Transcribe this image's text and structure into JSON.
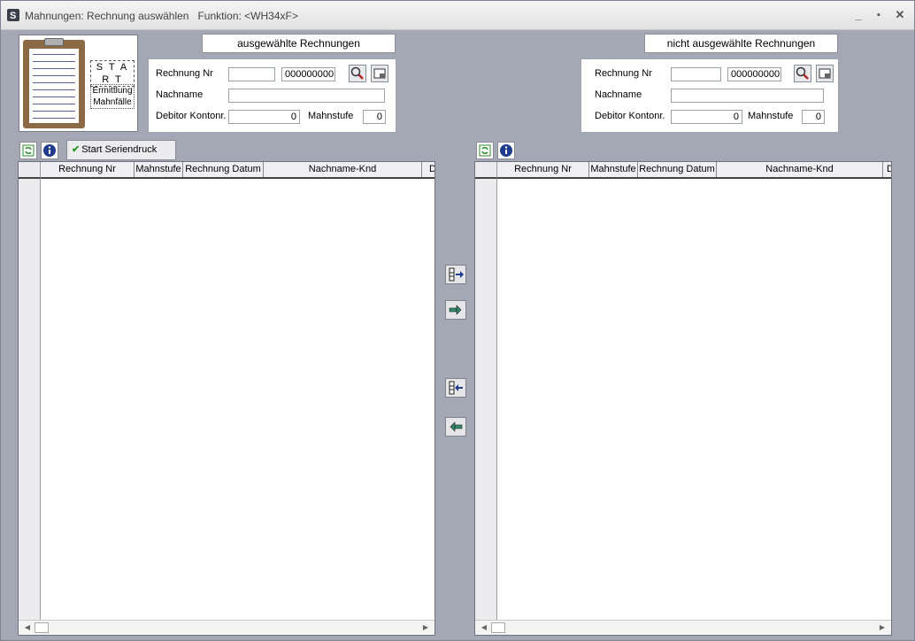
{
  "window": {
    "title": "Mahnungen: Rechnung auswählen   Funktion: <WH34xF>",
    "minimize": "_",
    "maximize": "▪",
    "close": "✕"
  },
  "start_panel": {
    "start_label": "S T A R T",
    "ermittlung_label": "Ermittlung Mahnfälle"
  },
  "left": {
    "header": "ausgewählte Rechnungen",
    "filter": {
      "rechnung_label": "Rechnung Nr",
      "rechnung_from": "",
      "rechnung_to": "000000000",
      "nachname_label": "Nachname",
      "nachname_value": "",
      "debitor_label": "Debitor Kontonr.",
      "debitor_value": "0",
      "mahnstufe_label": "Mahnstufe",
      "mahnstufe_value": "0"
    },
    "serien_button": "Start Seriendruck",
    "columns": [
      "Rechnung Nr",
      "Mahnstufe",
      "Rechnung Datum",
      "Nachname-Knd",
      "D"
    ]
  },
  "right": {
    "header": "nicht ausgewählte Rechnungen",
    "filter": {
      "rechnung_label": "Rechnung Nr",
      "rechnung_from": "",
      "rechnung_to": "000000000",
      "nachname_label": "Nachname",
      "nachname_value": "",
      "debitor_label": "Debitor Kontonr.",
      "debitor_value": "0",
      "mahnstufe_label": "Mahnstufe",
      "mahnstufe_value": "0"
    },
    "columns": [
      "Rechnung Nr",
      "Mahnstufe",
      "Rechnung Datum",
      "Nachname-Knd",
      "D"
    ]
  },
  "icons": {
    "search": "search-filter-icon",
    "clear": "clear-filter-icon",
    "refresh": "refresh-icon",
    "info": "info-icon",
    "move_all_right": "move-all-right-icon",
    "move_right": "move-right-icon",
    "move_all_left": "move-all-left-icon",
    "move_left": "move-left-icon"
  },
  "colors": {
    "background": "#a4a8b5",
    "accent_green": "#2e9a2e",
    "accent_blue": "#1f3c8f"
  }
}
